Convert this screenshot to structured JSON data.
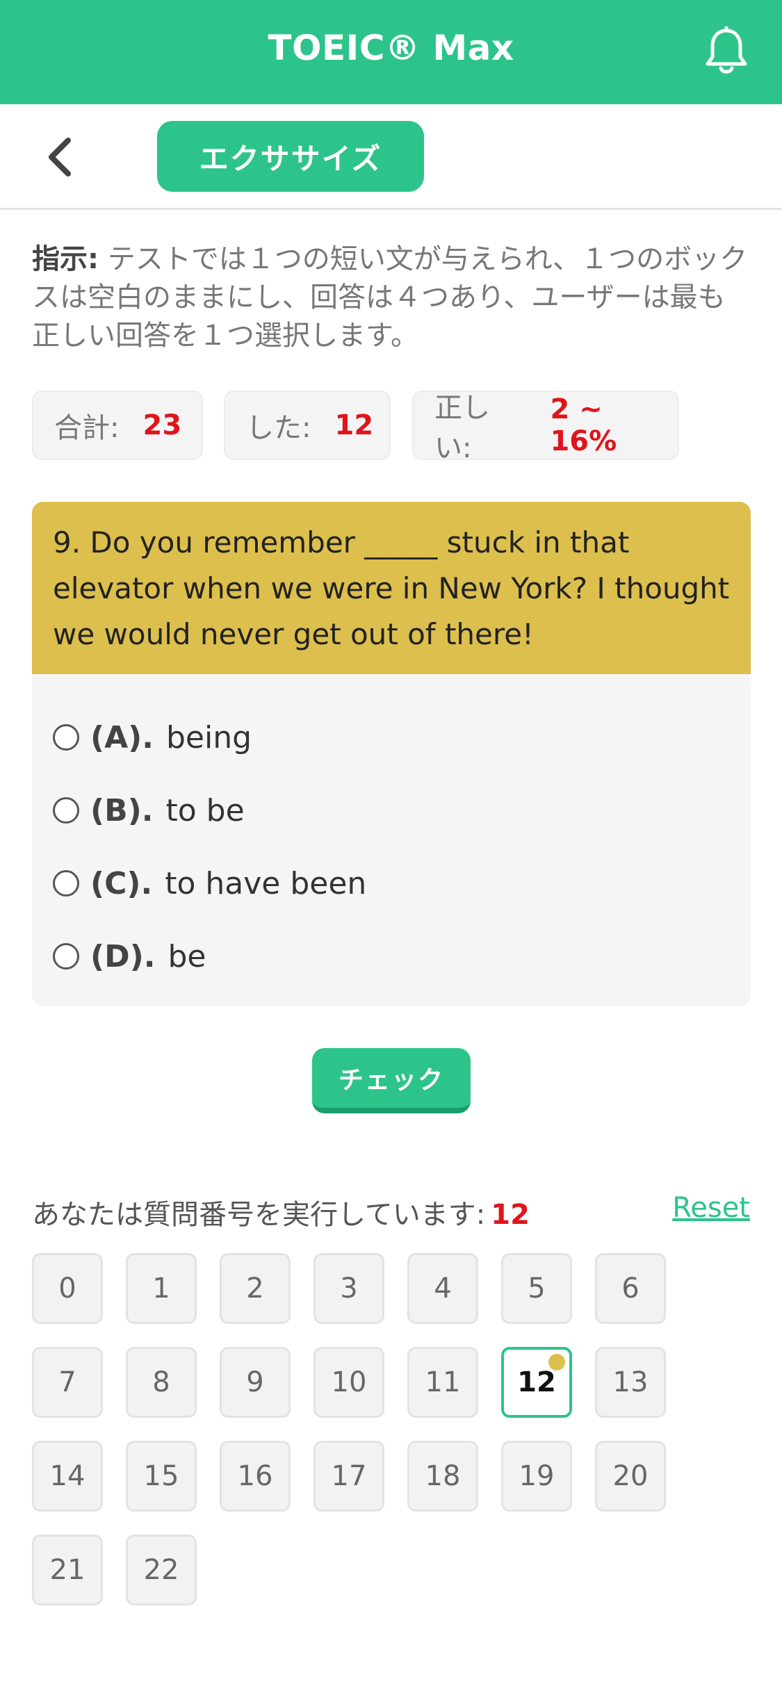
{
  "header": {
    "title": "TOEIC® Max",
    "icon": "bell-icon",
    "color": "#2cc48a"
  },
  "subheader": {
    "back_icon": "chevron-left-icon",
    "tab_label": "エクササイズ"
  },
  "instructions": {
    "label": "指示:",
    "text": " テストでは１つの短い文が与えられ、１つのボックスは空白のままにし、回答は４つあり、ユーザーは最も正しい回答を１つ選択します。"
  },
  "stats": {
    "total_label": "合計:",
    "total_value": "23",
    "done_label": "した:",
    "done_value": "12",
    "correct_label": "正しい:",
    "correct_value": "2 ~ 16%"
  },
  "question": {
    "text": "9. Do you remember _____ stuck in that elevator when we were in New York? I thought we would never get out of there!",
    "options": [
      {
        "letter": "(A).",
        "text": "being"
      },
      {
        "letter": "(B).",
        "text": "to be"
      },
      {
        "letter": "(C).",
        "text": "to have been"
      },
      {
        "letter": "(D).",
        "text": "be"
      }
    ]
  },
  "check_button": "チェック",
  "progress": {
    "label": "あなたは質問番号を実行しています:",
    "current": "12",
    "reset_label": "Reset"
  },
  "numbers": [
    "0",
    "1",
    "2",
    "3",
    "4",
    "5",
    "6",
    "7",
    "8",
    "9",
    "10",
    "11",
    "12",
    "13",
    "14",
    "15",
    "16",
    "17",
    "18",
    "19",
    "20",
    "21",
    "22"
  ],
  "active_number": "12",
  "colors": {
    "accent": "#2cc48a",
    "question_bg": "#dcbf4d",
    "highlight": "#e0141b"
  }
}
